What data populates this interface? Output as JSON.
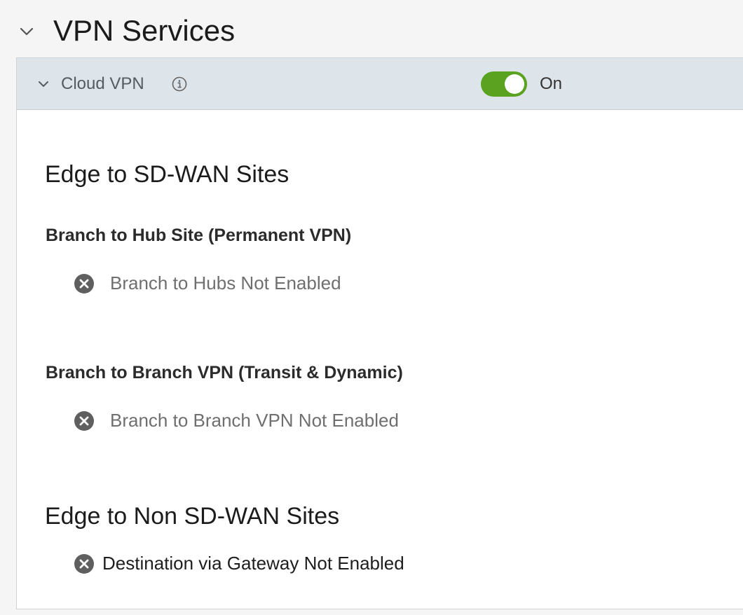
{
  "section": {
    "title": "VPN Services"
  },
  "cloud_vpn": {
    "title": "Cloud VPN",
    "toggle_state": "On",
    "toggle_on": true,
    "accent_color": "#5aa220"
  },
  "edge_to_sdwan": {
    "heading": "Edge to SD-WAN Sites",
    "branch_to_hub": {
      "heading": "Branch to Hub Site (Permanent VPN)",
      "status": "Branch to Hubs Not Enabled",
      "icon": "close-circle-icon"
    },
    "branch_to_branch": {
      "heading": "Branch to Branch VPN (Transit & Dynamic)",
      "status": "Branch to Branch VPN Not Enabled",
      "icon": "close-circle-icon"
    }
  },
  "edge_to_non_sdwan": {
    "heading": "Edge to Non SD-WAN Sites",
    "status": "Destination via Gateway Not Enabled",
    "icon": "close-circle-icon"
  }
}
